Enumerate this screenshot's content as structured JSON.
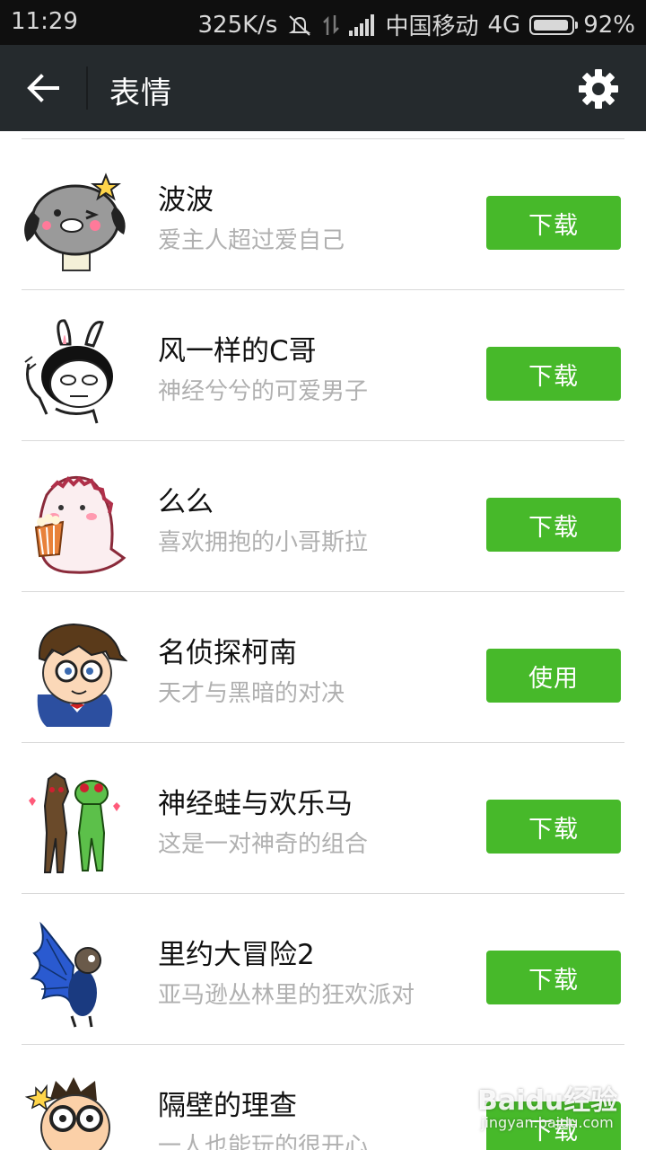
{
  "status_bar": {
    "time": "11:29",
    "speed": "325K/s",
    "carrier": "中国移动",
    "network": "4G",
    "battery": "92%"
  },
  "app_bar": {
    "title": "表情",
    "back_icon": "arrow-left-icon",
    "settings_icon": "gear-icon"
  },
  "items": [
    {
      "name": "波波",
      "desc": "爱主人超过爱自己",
      "button": "下载"
    },
    {
      "name": "风一样的C哥",
      "desc": "神经兮兮的可爱男子",
      "button": "下载"
    },
    {
      "name": "么么",
      "desc": "喜欢拥抱的小哥斯拉",
      "button": "下载"
    },
    {
      "name": "名侦探柯南",
      "desc": "天才与黑暗的对决",
      "button": "使用"
    },
    {
      "name": "神经蛙与欢乐马",
      "desc": "这是一对神奇的组合",
      "button": "下载"
    },
    {
      "name": "里约大冒险2",
      "desc": "亚马逊丛林里的狂欢派对",
      "button": "下载"
    },
    {
      "name": "隔壁的理查",
      "desc": "一人也能玩的很开心",
      "button": "下载"
    }
  ],
  "watermark": {
    "main": "Baidu经验",
    "sub": "jingyan.baidu.com"
  },
  "colors": {
    "accent_green": "#47b92a",
    "app_bar": "#252a2d",
    "status_bar": "#0f0f0f"
  }
}
